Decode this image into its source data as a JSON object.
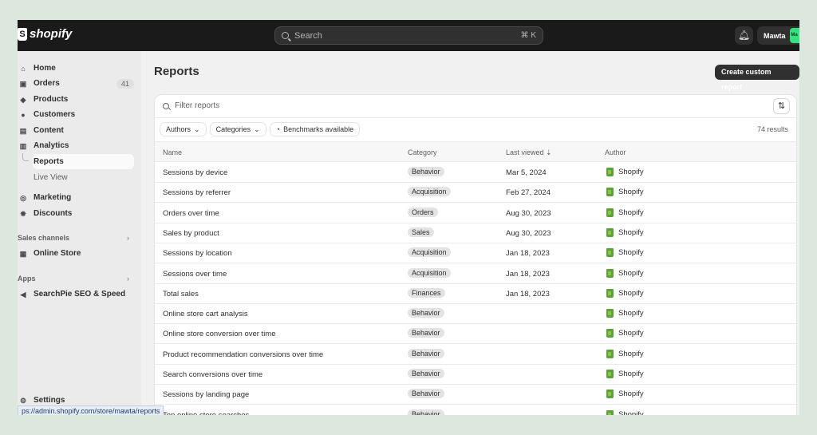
{
  "topbar": {
    "logo_text": "shopify",
    "search_placeholder": "Search",
    "search_shortcut": "⌘ K",
    "store_name": "Mawta",
    "store_avatar": "Ma"
  },
  "sidebar": {
    "items": [
      {
        "label": "Home",
        "icon": "home-icon"
      },
      {
        "label": "Orders",
        "icon": "orders-icon",
        "count": "41"
      },
      {
        "label": "Products",
        "icon": "tag-icon"
      },
      {
        "label": "Customers",
        "icon": "person-icon"
      },
      {
        "label": "Content",
        "icon": "content-icon"
      },
      {
        "label": "Analytics",
        "icon": "analytics-icon"
      }
    ],
    "analytics_sub": [
      {
        "label": "Reports",
        "selected": true
      },
      {
        "label": "Live View",
        "selected": false
      }
    ],
    "items2": [
      {
        "label": "Marketing",
        "icon": "target-icon"
      },
      {
        "label": "Discounts",
        "icon": "discount-icon"
      }
    ],
    "sales_channels_label": "Sales channels",
    "online_store_label": "Online Store",
    "apps_label": "Apps",
    "app_item_label": "SearchPie SEO & Speed",
    "settings_label": "Settings"
  },
  "status_url": "ps://admin.shopify.com/store/mawta/reports",
  "main": {
    "title": "Reports",
    "create_button": "Create custom report",
    "filter_placeholder": "Filter reports",
    "chips": [
      "Authors",
      "Categories",
      "Benchmarks available"
    ],
    "results": "74 results",
    "columns": [
      "Name",
      "Category",
      "Last viewed",
      "Author"
    ],
    "rows": [
      {
        "name": "Sessions by device",
        "category": "Behavior",
        "last_viewed": "Mar 5, 2024",
        "author": "Shopify"
      },
      {
        "name": "Sessions by referrer",
        "category": "Acquisition",
        "last_viewed": "Feb 27, 2024",
        "author": "Shopify"
      },
      {
        "name": "Orders over time",
        "category": "Orders",
        "last_viewed": "Aug 30, 2023",
        "author": "Shopify"
      },
      {
        "name": "Sales by product",
        "category": "Sales",
        "last_viewed": "Aug 30, 2023",
        "author": "Shopify"
      },
      {
        "name": "Sessions by location",
        "category": "Acquisition",
        "last_viewed": "Jan 18, 2023",
        "author": "Shopify"
      },
      {
        "name": "Sessions over time",
        "category": "Acquisition",
        "last_viewed": "Jan 18, 2023",
        "author": "Shopify"
      },
      {
        "name": "Total sales",
        "category": "Finances",
        "last_viewed": "Jan 18, 2023",
        "author": "Shopify"
      },
      {
        "name": "Online store cart analysis",
        "category": "Behavior",
        "last_viewed": "",
        "author": "Shopify"
      },
      {
        "name": "Online store conversion over time",
        "category": "Behavior",
        "last_viewed": "",
        "author": "Shopify"
      },
      {
        "name": "Product recommendation conversions over time",
        "category": "Behavior",
        "last_viewed": "",
        "author": "Shopify"
      },
      {
        "name": "Search conversions over time",
        "category": "Behavior",
        "last_viewed": "",
        "author": "Shopify"
      },
      {
        "name": "Sessions by landing page",
        "category": "Behavior",
        "last_viewed": "",
        "author": "Shopify"
      },
      {
        "name": "Top online store searches",
        "category": "Behavior",
        "last_viewed": "",
        "author": "Shopify"
      }
    ]
  }
}
